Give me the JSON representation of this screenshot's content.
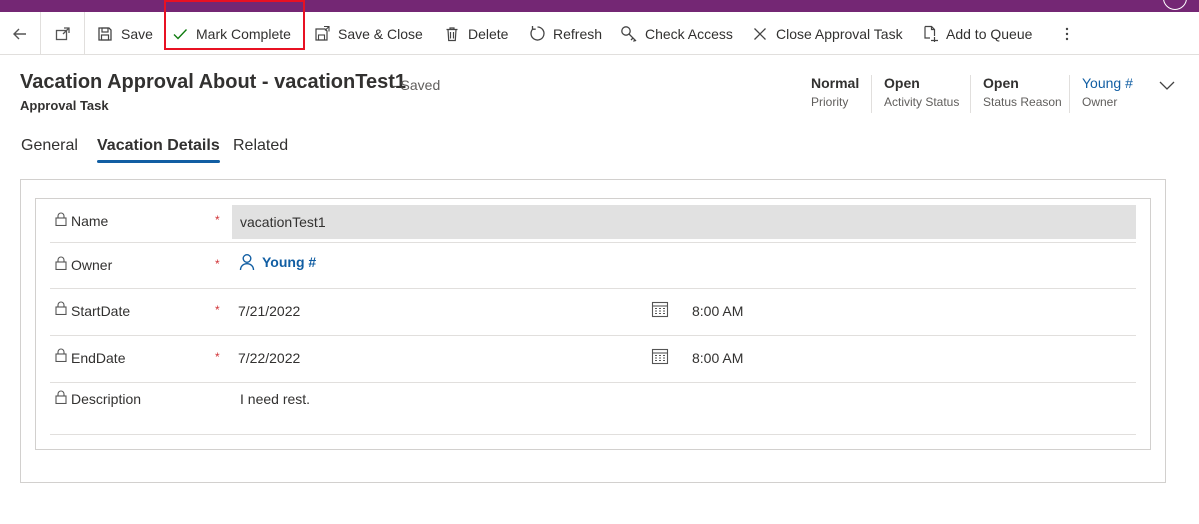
{
  "toolbar": {
    "back_icon": "arrow-left-icon",
    "popout_icon": "open-in-new-window-icon",
    "save": {
      "label": "Save",
      "icon": "floppy-disk-icon"
    },
    "mark_complete": {
      "label": "Mark Complete",
      "icon": "checkmark-icon"
    },
    "save_close": {
      "label": "Save & Close",
      "icon": "save-close-icon"
    },
    "delete": {
      "label": "Delete",
      "icon": "trash-icon"
    },
    "refresh": {
      "label": "Refresh",
      "icon": "refresh-icon"
    },
    "check_access": {
      "label": "Check Access",
      "icon": "key-search-icon"
    },
    "close_task": {
      "label": "Close Approval Task",
      "icon": "close-icon"
    },
    "add_queue": {
      "label": "Add to Queue",
      "icon": "queue-document-icon"
    },
    "more_icon": "more-vertical-icon"
  },
  "header": {
    "title": "Vacation Approval About - vacationTest1",
    "save_status": "- Saved",
    "entity": "Approval Task",
    "fields": [
      {
        "value": "Normal",
        "label": "Priority"
      },
      {
        "value": "Open",
        "label": "Activity Status"
      },
      {
        "value": "Open",
        "label": "Status Reason"
      },
      {
        "value": "Young #",
        "label": "Owner"
      }
    ]
  },
  "tabs": [
    {
      "label": "General",
      "active": false
    },
    {
      "label": "Vacation Details",
      "active": true
    },
    {
      "label": "Related",
      "active": false
    }
  ],
  "form": {
    "required_mark": "*",
    "name": {
      "label": "Name",
      "value": "vacationTest1"
    },
    "owner": {
      "label": "Owner",
      "value": "Young #"
    },
    "start": {
      "label": "StartDate",
      "date": "7/21/2022",
      "time": "8:00 AM"
    },
    "end": {
      "label": "EndDate",
      "date": "7/22/2022",
      "time": "8:00 AM"
    },
    "description": {
      "label": "Description",
      "value": "I need rest."
    }
  },
  "colors": {
    "brand_bar": "#742774",
    "link": "#115ea3",
    "required": "#d13438",
    "highlight": "#e81123"
  }
}
